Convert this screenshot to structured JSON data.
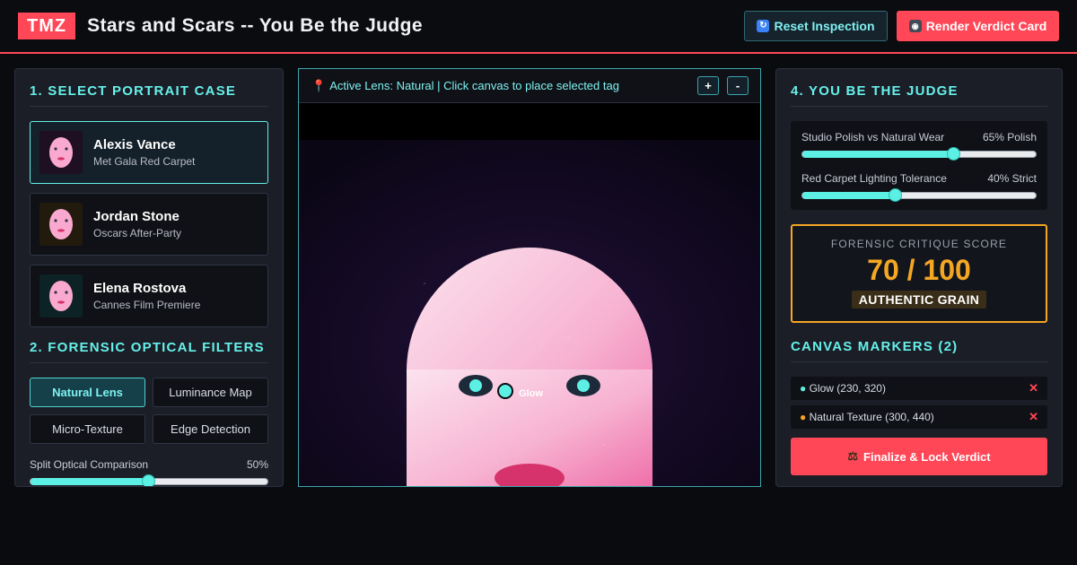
{
  "header": {
    "logo": "TMZ",
    "title": "Stars and Scars -- You Be the Judge",
    "reset_label": "Reset Inspection",
    "render_label": "Render Verdict Card"
  },
  "cases": {
    "title": "1. SELECT PORTRAIT CASE",
    "items": [
      {
        "name": "Alexis Vance",
        "event": "Met Gala Red Carpet"
      },
      {
        "name": "Jordan Stone",
        "event": "Oscars After-Party"
      },
      {
        "name": "Elena Rostova",
        "event": "Cannes Film Premiere"
      }
    ]
  },
  "filters": {
    "title": "2. FORENSIC OPTICAL FILTERS",
    "items": [
      "Natural Lens",
      "Luminance Map",
      "Micro-Texture",
      "Edge Detection"
    ],
    "split_label": "Split Optical Comparison",
    "split_value": "50%",
    "split_fraction": 0.5
  },
  "canvas": {
    "status": "Active Lens: Natural | Click canvas to place selected tag",
    "zoom_in": "+",
    "zoom_out": "-",
    "tag_label": "Glow"
  },
  "judge": {
    "title": "4. YOU BE THE JUDGE",
    "polish_label": "Studio Polish vs Natural Wear",
    "polish_value": "65% Polish",
    "polish_fraction": 0.65,
    "lighting_label": "Red Carpet Lighting Tolerance",
    "lighting_value": "40% Strict",
    "lighting_fraction": 0.4
  },
  "score": {
    "label": "FORENSIC CRITIQUE SCORE",
    "value": "70 / 100",
    "badge": "AUTHENTIC GRAIN"
  },
  "markers": {
    "title": "CANVAS MARKERS (2)",
    "items": [
      {
        "text": "Glow (230, 320)",
        "color": "#5cf0e5"
      },
      {
        "text": "Natural Texture (300, 440)",
        "color": "#f5a623"
      }
    ],
    "remove_glyph": "✕"
  },
  "finalize_label": "Finalize & Lock Verdict",
  "colors": {
    "accent": "#ff4757",
    "cyan": "#66f0ea",
    "gold": "#f5a623"
  }
}
